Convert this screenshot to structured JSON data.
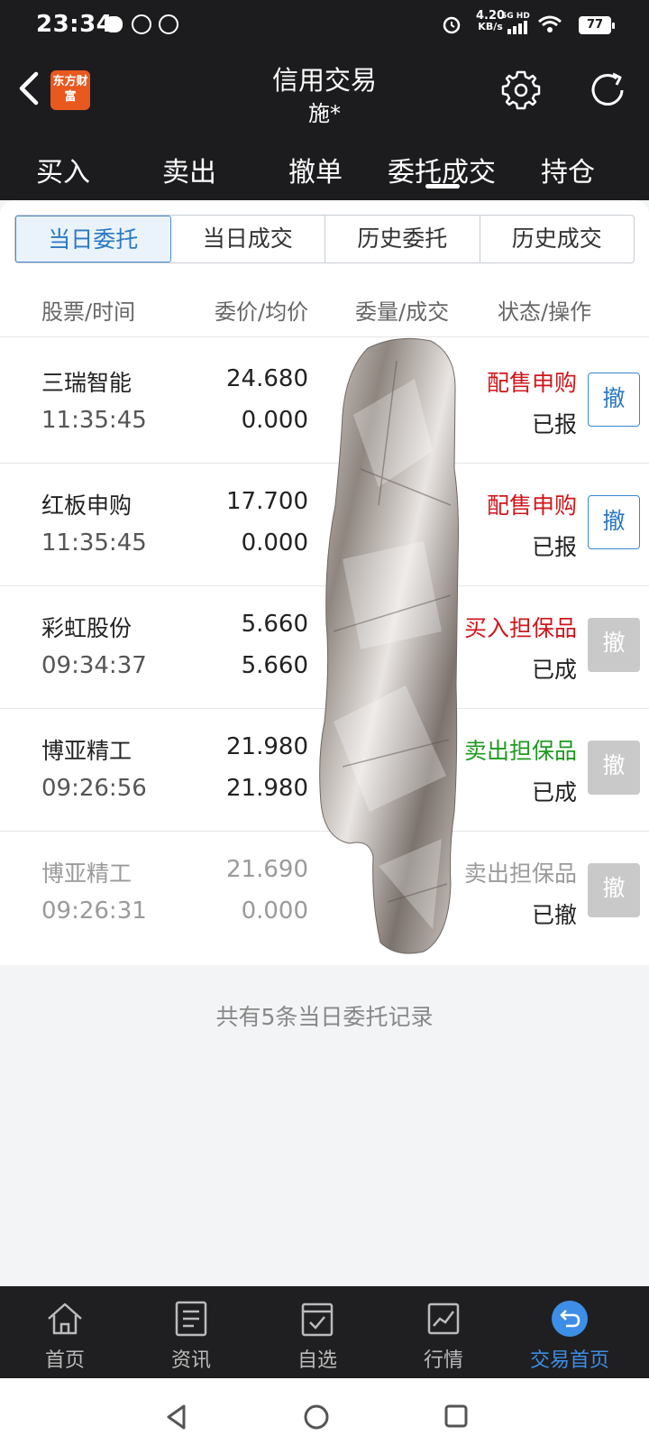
{
  "status_bar": {
    "time": "23:34",
    "net_speed_value": "4.20",
    "net_speed_unit": "KB/s",
    "network": "5G HD",
    "battery": "77"
  },
  "header": {
    "logo_text": "东方财富",
    "title": "信用交易",
    "subtitle": "施*",
    "tabs": [
      "买入",
      "卖出",
      "撤单",
      "委托成交",
      "持仓"
    ],
    "active_tab": "委托成交"
  },
  "segments": [
    "当日委托",
    "当日成交",
    "历史委托",
    "历史成交"
  ],
  "active_segment": "当日委托",
  "columns": [
    "股票/时间",
    "委价/均价",
    "委量/成交",
    "状态/操作"
  ],
  "orders": [
    {
      "name": "三瑞智能",
      "time": "11:35:45",
      "price": "24.680",
      "avg": "0.000",
      "type": "配售申购",
      "type_color": "red",
      "status": "已报",
      "action": "撤",
      "action_enabled": true
    },
    {
      "name": "红板申购",
      "time": "11:35:45",
      "price": "17.700",
      "avg": "0.000",
      "type": "配售申购",
      "type_color": "red",
      "status": "已报",
      "action": "撤",
      "action_enabled": true
    },
    {
      "name": "彩虹股份",
      "time": "09:34:37",
      "price": "5.660",
      "avg": "5.660",
      "type": "买入担保品",
      "type_color": "red",
      "status": "已成",
      "action": "撤",
      "action_enabled": false
    },
    {
      "name": "博亚精工",
      "time": "09:26:56",
      "price": "21.980",
      "avg": "21.980",
      "type": "卖出担保品",
      "type_color": "green",
      "status": "已成",
      "action": "撤",
      "action_enabled": false
    },
    {
      "name": "博亚精工",
      "time": "09:26:31",
      "price": "21.690",
      "avg": "0.000",
      "type": "卖出担保品",
      "type_color": "gray",
      "status": "已撤",
      "action": "撤",
      "action_enabled": false
    }
  ],
  "summary": "共有5条当日委托记录",
  "bottom_nav": [
    {
      "label": "首页",
      "icon": "home-icon"
    },
    {
      "label": "资讯",
      "icon": "news-icon"
    },
    {
      "label": "自选",
      "icon": "watchlist-icon"
    },
    {
      "label": "行情",
      "icon": "market-icon"
    },
    {
      "label": "交易首页",
      "icon": "trade-home-icon",
      "active": true
    }
  ],
  "colors": {
    "accent": "#2b79c2",
    "up": "#d0161b",
    "down": "#1f9a1f",
    "dark": "#1c1c1e"
  }
}
